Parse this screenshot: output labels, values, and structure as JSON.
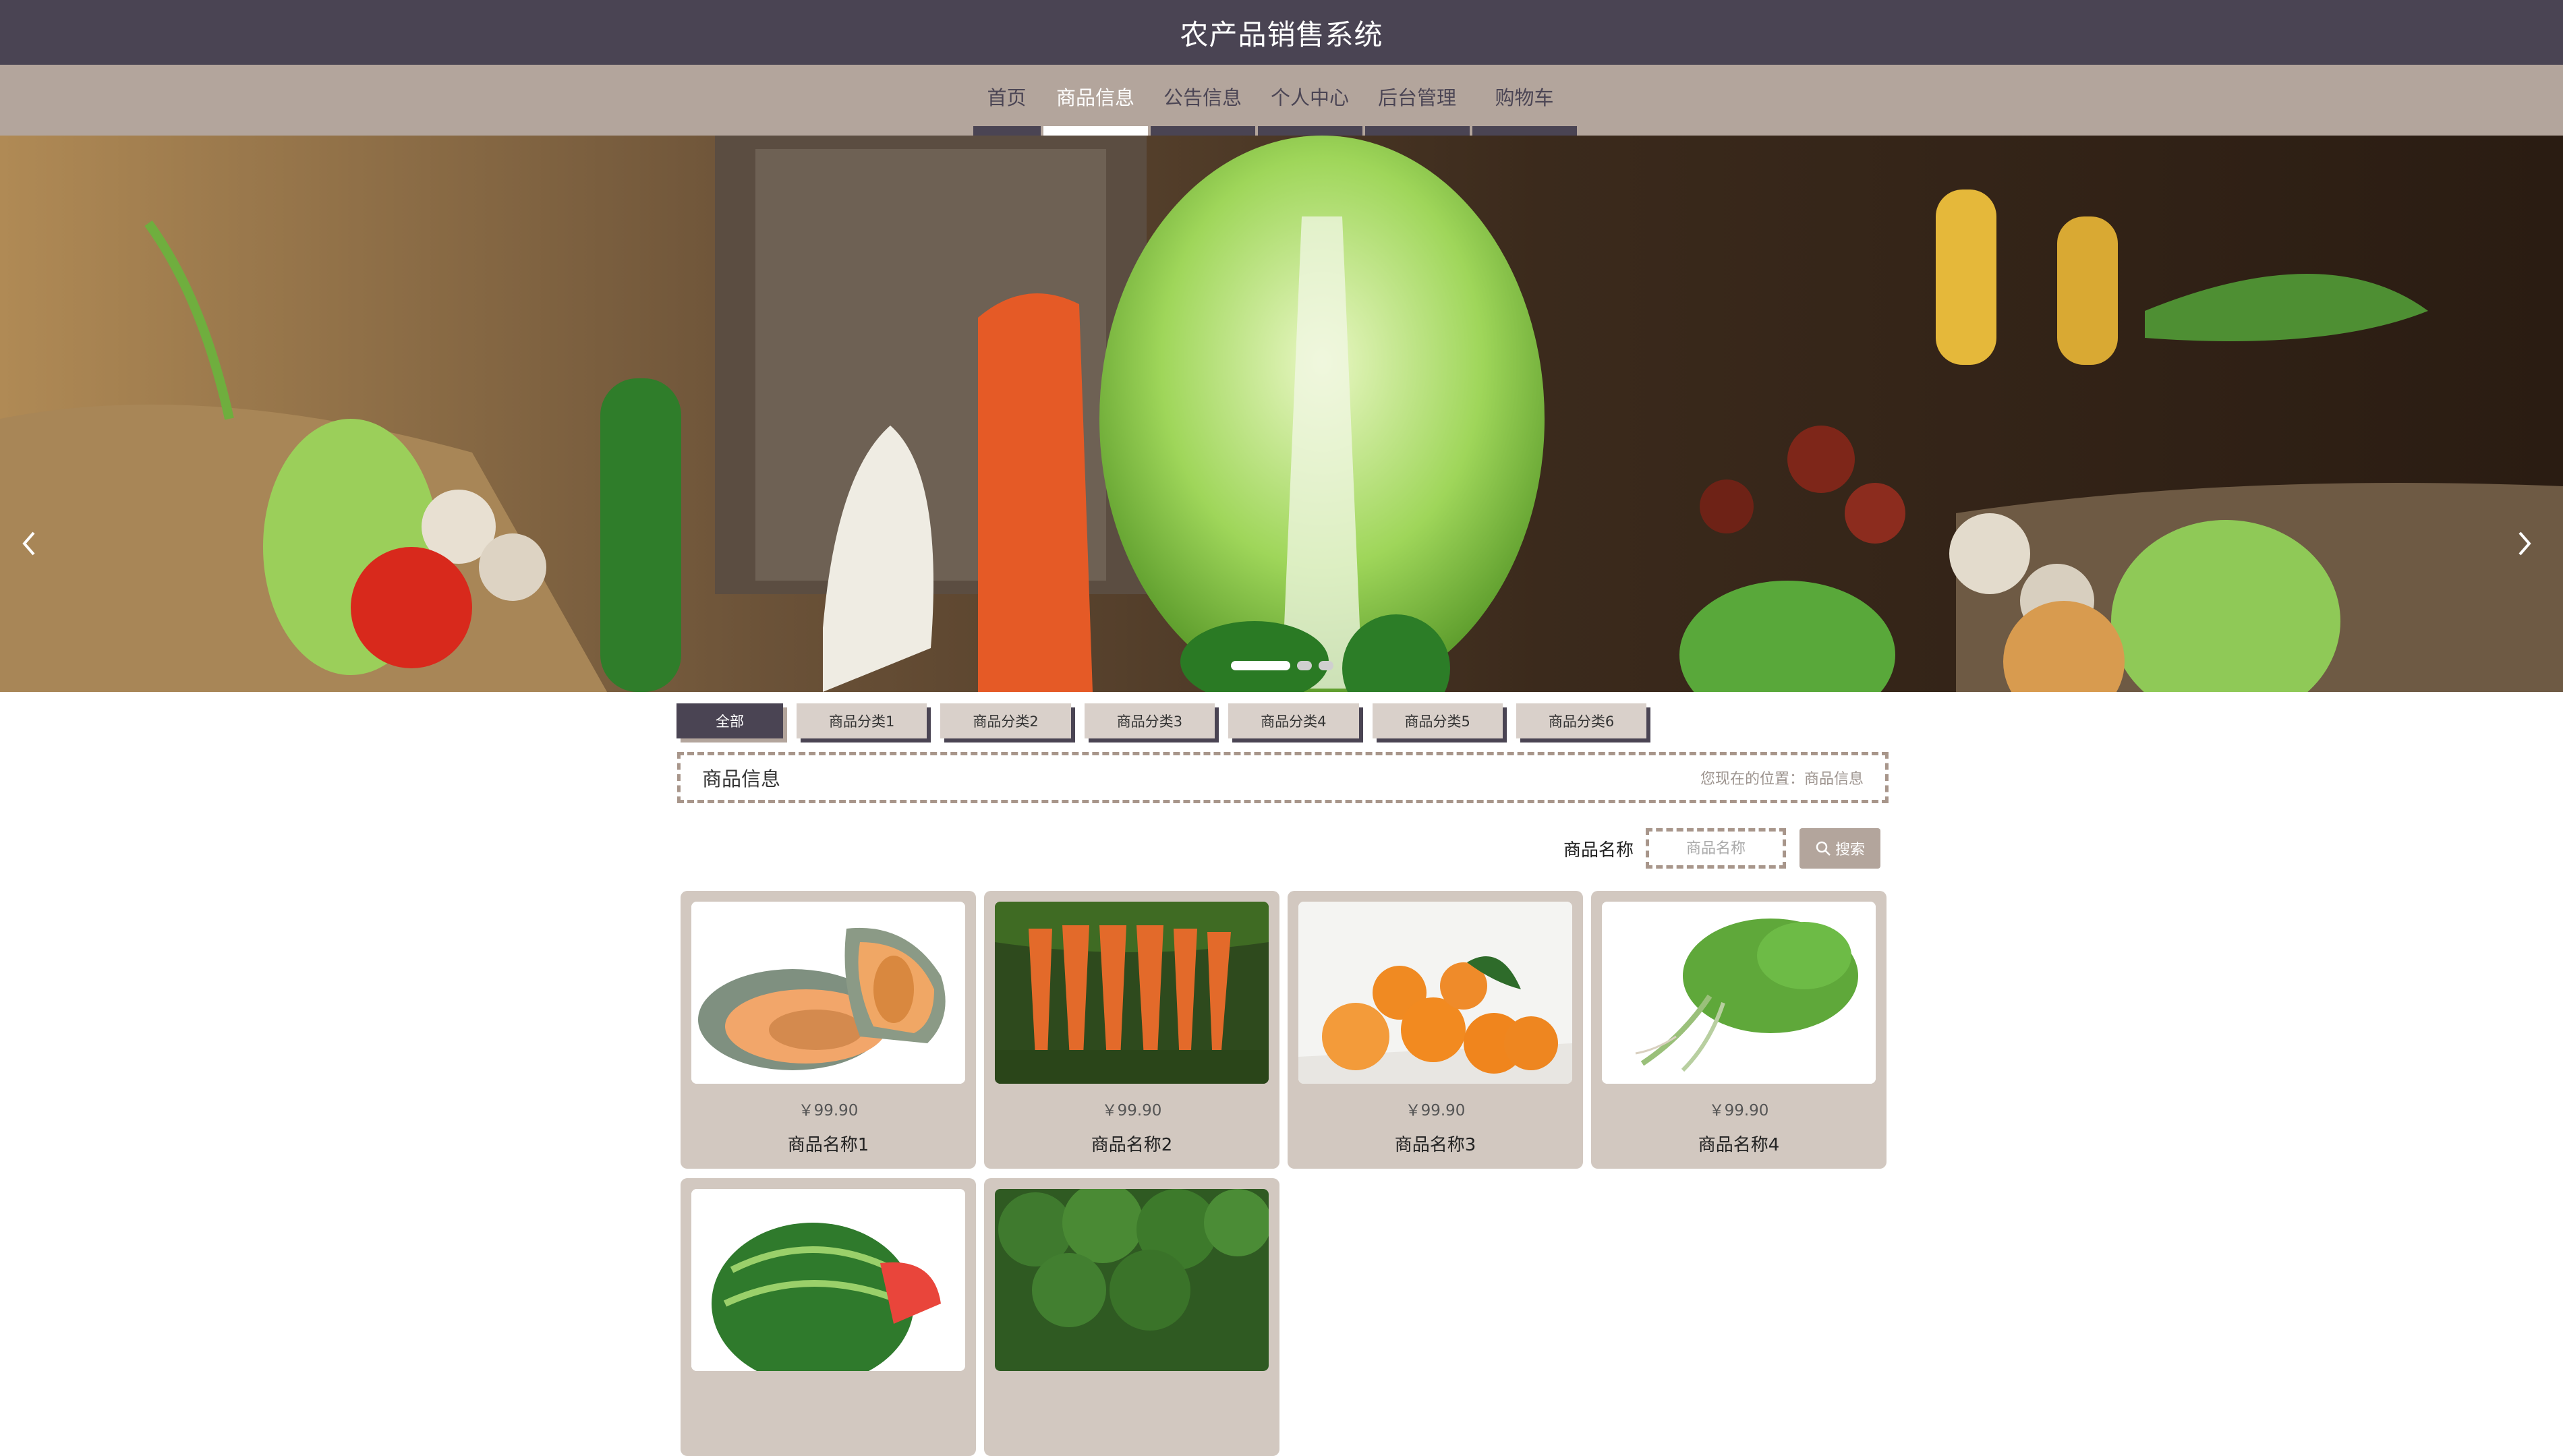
{
  "header": {
    "title": "农产品销售系统"
  },
  "nav": {
    "items": [
      {
        "label": "首页"
      },
      {
        "label": "商品信息"
      },
      {
        "label": "公告信息"
      },
      {
        "label": "个人中心"
      },
      {
        "label": "后台管理"
      },
      {
        "label": "购物车"
      }
    ],
    "active_index": 1
  },
  "banner": {
    "prev_icon": "chevron-left-icon",
    "next_icon": "chevron-right-icon",
    "slide_count": 3,
    "active_slide": 1
  },
  "categories": {
    "items": [
      {
        "label": "全部"
      },
      {
        "label": "商品分类1"
      },
      {
        "label": "商品分类2"
      },
      {
        "label": "商品分类3"
      },
      {
        "label": "商品分类4"
      },
      {
        "label": "商品分类5"
      },
      {
        "label": "商品分类6"
      }
    ],
    "active_index": 0
  },
  "breadcrumb": {
    "heading": "商品信息",
    "location": "您现在的位置：商品信息"
  },
  "search": {
    "label": "商品名称",
    "placeholder": "商品名称",
    "button_label": "搜索",
    "button_icon": "search-icon"
  },
  "products": [
    {
      "price": "￥99.90",
      "name": "商品名称1",
      "image": "cantaloupe"
    },
    {
      "price": "￥99.90",
      "name": "商品名称2",
      "image": "carrots"
    },
    {
      "price": "￥99.90",
      "name": "商品名称3",
      "image": "oranges"
    },
    {
      "price": "￥99.90",
      "name": "商品名称4",
      "image": "celery"
    },
    {
      "price": "",
      "name": "",
      "image": "watermelon"
    },
    {
      "price": "",
      "name": "",
      "image": "broccoli"
    }
  ],
  "colors": {
    "header_bg": "#4a4453",
    "nav_bg": "#b3a59c",
    "card_bg": "#d2c8c0",
    "accent": "#a8968b"
  }
}
